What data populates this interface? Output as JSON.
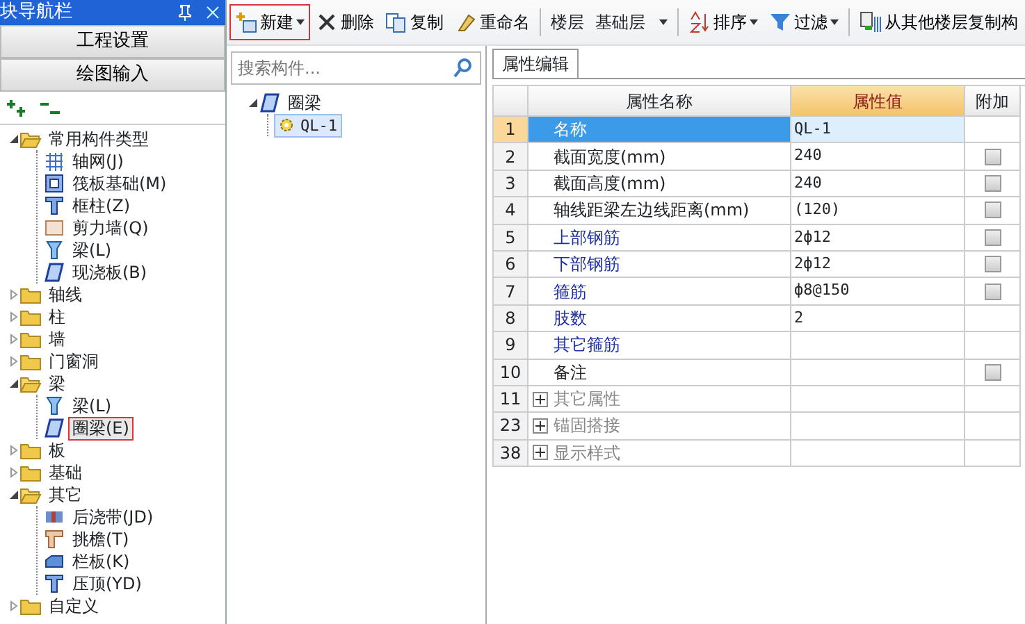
{
  "nav_panel": {
    "title": "块导航栏",
    "sections": [
      "工程设置",
      "绘图输入"
    ],
    "tree": [
      {
        "label": "常用构件类型",
        "kind": "folder",
        "expanded": true,
        "selected": false,
        "children": [
          {
            "label": "轴网(J)",
            "kind": "grid",
            "selected": false
          },
          {
            "label": "筏板基础(M)",
            "kind": "raft",
            "selected": false
          },
          {
            "label": "框柱(Z)",
            "kind": "column",
            "selected": false
          },
          {
            "label": "剪力墙(Q)",
            "kind": "wall",
            "selected": false
          },
          {
            "label": "梁(L)",
            "kind": "beam",
            "selected": false
          },
          {
            "label": "现浇板(B)",
            "kind": "slab",
            "selected": false
          }
        ]
      },
      {
        "label": "轴线",
        "kind": "folder",
        "expanded": false,
        "selected": false
      },
      {
        "label": "柱",
        "kind": "folder",
        "expanded": false,
        "selected": false
      },
      {
        "label": "墙",
        "kind": "folder",
        "expanded": false,
        "selected": false
      },
      {
        "label": "门窗洞",
        "kind": "folder",
        "expanded": false,
        "selected": false
      },
      {
        "label": "梁",
        "kind": "folder",
        "expanded": true,
        "selected": false,
        "children": [
          {
            "label": "梁(L)",
            "kind": "beam",
            "selected": false
          },
          {
            "label": "圈梁(E)",
            "kind": "slab",
            "selected": true
          }
        ]
      },
      {
        "label": "板",
        "kind": "folder",
        "expanded": false,
        "selected": false
      },
      {
        "label": "基础",
        "kind": "folder",
        "expanded": false,
        "selected": false
      },
      {
        "label": "其它",
        "kind": "folder",
        "expanded": true,
        "selected": false,
        "children": [
          {
            "label": "后浇带(JD)",
            "kind": "band",
            "selected": false
          },
          {
            "label": "挑檐(T)",
            "kind": "eave",
            "selected": false
          },
          {
            "label": "栏板(K)",
            "kind": "parapet",
            "selected": false
          },
          {
            "label": "压顶(YD)",
            "kind": "column",
            "selected": false
          }
        ]
      },
      {
        "label": "自定义",
        "kind": "folder",
        "expanded": false,
        "selected": false
      }
    ]
  },
  "toolbar": [
    {
      "kind": "new",
      "label": "新建",
      "dropdown": true,
      "outlined": true
    },
    {
      "kind": "delete",
      "label": "删除",
      "dropdown": false,
      "outlined": false
    },
    {
      "kind": "copy",
      "label": "复制",
      "dropdown": false,
      "outlined": false
    },
    {
      "kind": "rename",
      "label": "重命名",
      "dropdown": false,
      "outlined": false
    },
    {
      "kind": "separator"
    },
    {
      "kind": "text",
      "label": "楼层"
    },
    {
      "kind": "select",
      "label": "基础层"
    },
    {
      "kind": "separator"
    },
    {
      "kind": "sort",
      "label": "排序",
      "dropdown": true,
      "outlined": false
    },
    {
      "kind": "filter",
      "label": "过滤",
      "dropdown": true,
      "outlined": false
    },
    {
      "kind": "separator"
    },
    {
      "kind": "copyfloor",
      "label": "从其他楼层复制构",
      "dropdown": false,
      "outlined": false
    }
  ],
  "component_list": {
    "search": {
      "placeholder": "搜索构件..."
    },
    "tree": [
      {
        "label": "圈梁",
        "expanded": true,
        "children": [
          {
            "label": "QL-1",
            "selected": true
          }
        ]
      }
    ]
  },
  "properties": {
    "tabs": [
      {
        "label": "属性编辑",
        "selected": true
      }
    ],
    "columns": [
      "属性名称",
      "属性值",
      "附加"
    ],
    "rows": [
      {
        "num": "1",
        "name": "名称",
        "value": "QL-1",
        "kind": "plain",
        "selected": true
      },
      {
        "num": "2",
        "name": "截面宽度(mm)",
        "value": "240",
        "kind": "plain",
        "selected": false,
        "checkbox": {
          "checked": false
        }
      },
      {
        "num": "3",
        "name": "截面高度(mm)",
        "value": "240",
        "kind": "plain",
        "selected": false,
        "checkbox": {
          "checked": false
        }
      },
      {
        "num": "4",
        "name": "轴线距梁左边线距离(mm)",
        "value": "(120)",
        "kind": "plain",
        "selected": false,
        "checkbox": {
          "checked": false
        }
      },
      {
        "num": "5",
        "name": "上部钢筋",
        "value": "2ф12",
        "kind": "rebar",
        "selected": false,
        "checkbox": {
          "checked": false
        }
      },
      {
        "num": "6",
        "name": "下部钢筋",
        "value": "2ф12",
        "kind": "rebar",
        "selected": false,
        "checkbox": {
          "checked": false
        }
      },
      {
        "num": "7",
        "name": "箍筋",
        "value": "ф8@150",
        "kind": "rebar",
        "selected": false,
        "checkbox": {
          "checked": false
        }
      },
      {
        "num": "8",
        "name": "肢数",
        "value": "2",
        "kind": "rebar",
        "selected": false
      },
      {
        "num": "9",
        "name": "其它箍筋",
        "kind": "rebar",
        "selected": false
      },
      {
        "num": "10",
        "name": "备注",
        "kind": "plain",
        "selected": false,
        "checkbox": {
          "checked": false
        }
      },
      {
        "num": "11",
        "name": "其它属性",
        "kind": "group",
        "selected": false
      },
      {
        "num": "23",
        "name": "锚固搭接",
        "kind": "group",
        "selected": false
      },
      {
        "num": "38",
        "name": "显示样式",
        "kind": "group",
        "selected": false
      }
    ]
  }
}
